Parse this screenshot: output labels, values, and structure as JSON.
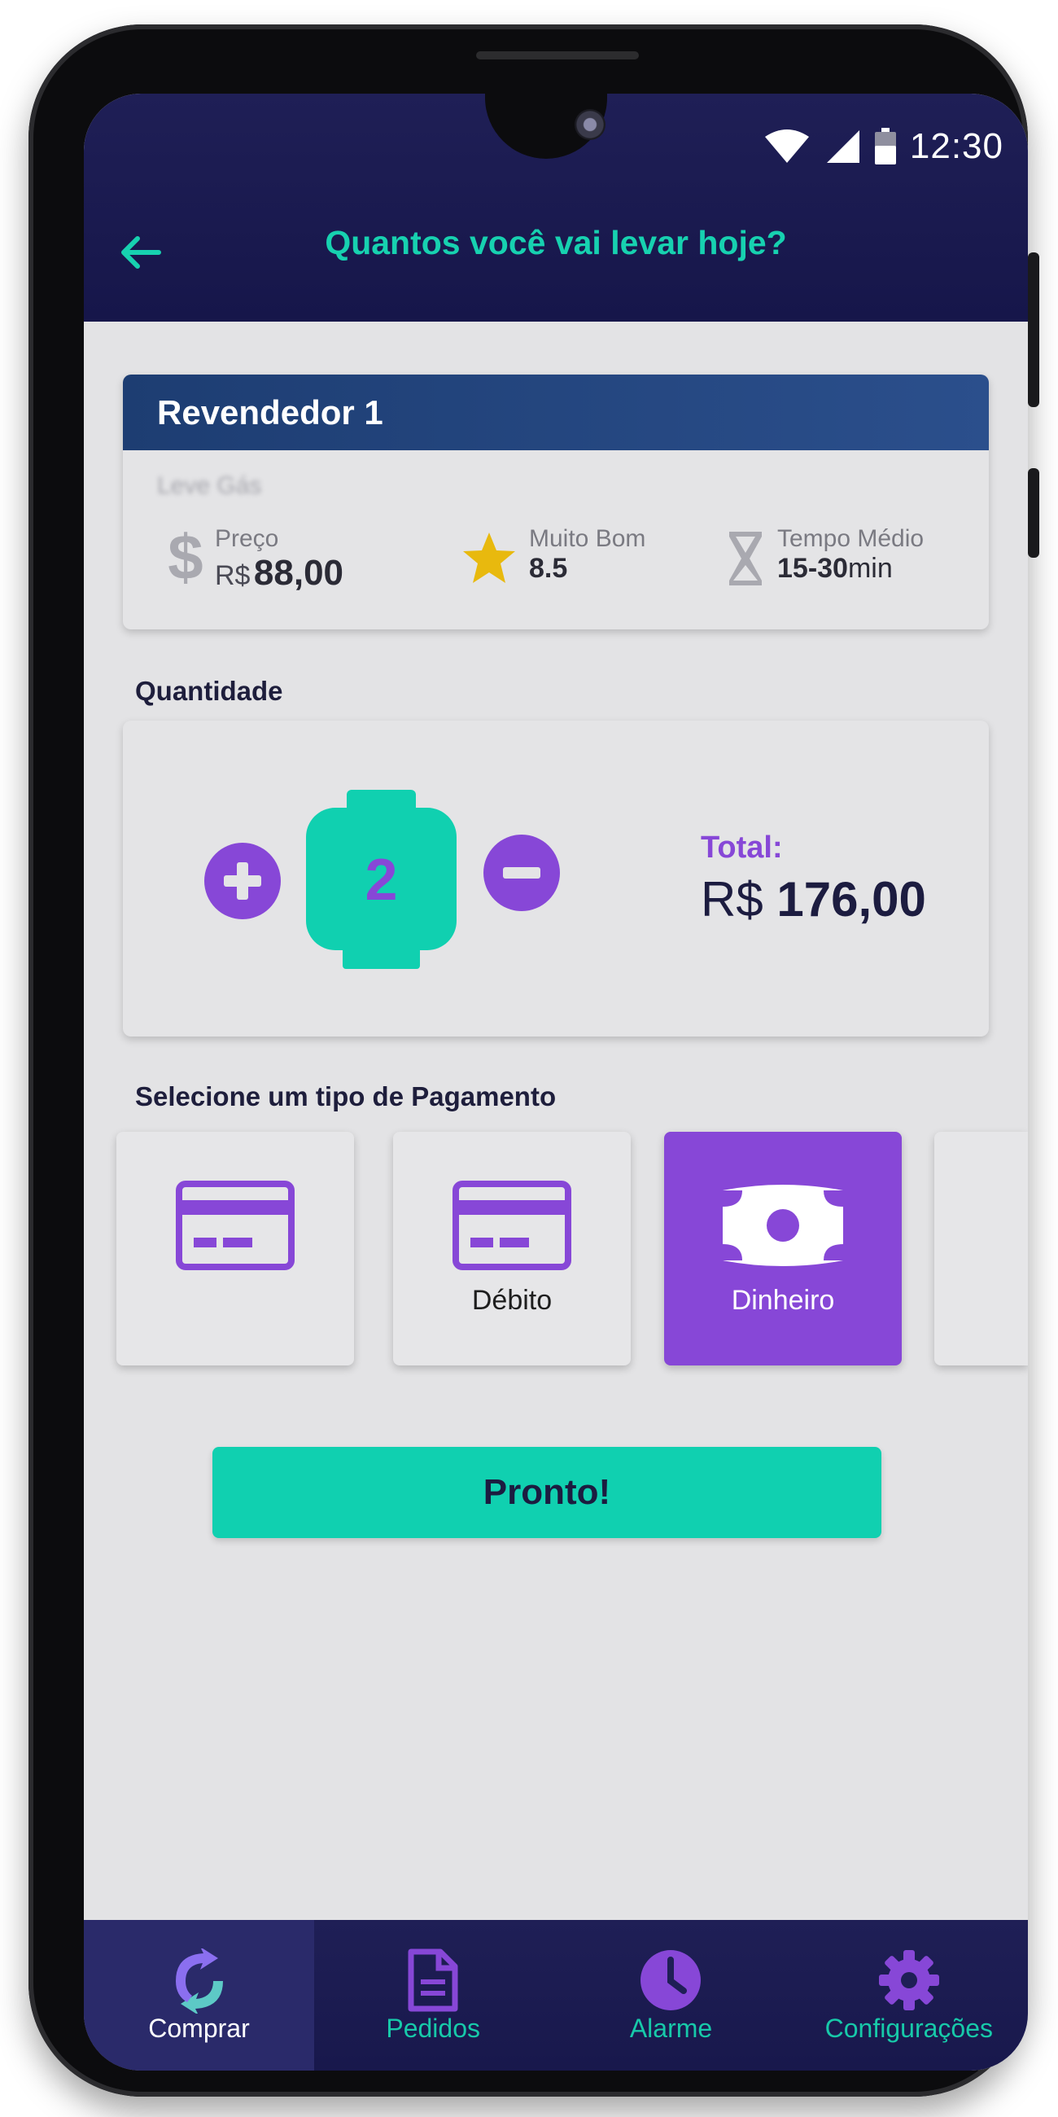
{
  "status_bar": {
    "time": "12:30"
  },
  "header": {
    "title": "Quantos você vai levar hoje?"
  },
  "reseller": {
    "name": "Revendedor 1",
    "subtitle": "Leve Gás",
    "price_label": "Preço",
    "price_currency": "R$",
    "price_value": "88,00",
    "rating_label": "Muito Bom",
    "rating_value": "8.5",
    "time_label": "Tempo Médio",
    "time_value": "15-30",
    "time_unit": "min"
  },
  "quantity": {
    "section_label": "Quantidade",
    "count": "2",
    "total_label": "Total:",
    "total_currency": "R$",
    "total_value": "176,00"
  },
  "payment": {
    "section_label": "Selecione um tipo de Pagamento",
    "options": [
      {
        "label": "",
        "icon": "credit-card-icon",
        "selected": false
      },
      {
        "label": "Débito",
        "icon": "debit-card-icon",
        "selected": false
      },
      {
        "label": "Dinheiro",
        "icon": "cash-icon",
        "selected": true
      }
    ]
  },
  "actions": {
    "done_label": "Pronto!"
  },
  "nav": {
    "items": [
      {
        "label": "Comprar",
        "icon": "swap-icon",
        "active": true
      },
      {
        "label": "Pedidos",
        "icon": "document-icon",
        "active": false
      },
      {
        "label": "Alarme",
        "icon": "clock-icon",
        "active": false
      },
      {
        "label": "Configurações",
        "icon": "gear-icon",
        "active": false
      }
    ]
  },
  "colors": {
    "accent_purple": "#8747d7",
    "accent_teal": "#10d0b0",
    "navy": "#1f1f56",
    "reseller_header": "#1d3d72"
  }
}
